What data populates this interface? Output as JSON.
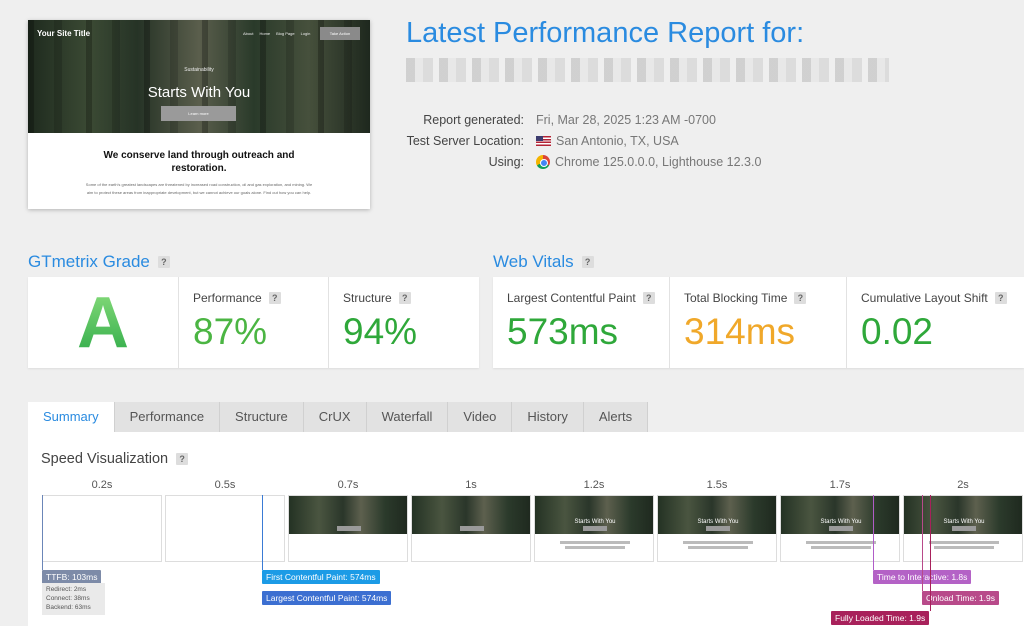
{
  "preview": {
    "site_title": "Your Site Title",
    "nav": [
      "About",
      "Home",
      "Blog Page",
      "Login"
    ],
    "cta": "Take Action",
    "kicker": "Sustainability",
    "heading": "Starts With You",
    "learn_more": "Learn more",
    "headline": "We conserve land through outreach and restoration.",
    "body": "Some of the earth's greatest landscapes are threatened by increased road construction, oil and gas exploration, and mining. We aim to protect these areas from inappropriate development, but we cannot achieve our goals alone. Find out how you can help."
  },
  "report": {
    "title": "Latest Performance Report for:",
    "meta": [
      {
        "label": "Report generated:",
        "value": "Fri, Mar 28, 2025 1:23 AM -0700",
        "icon": ""
      },
      {
        "label": "Test Server Location:",
        "value": "San Antonio, TX, USA",
        "icon": "us-flag-icon"
      },
      {
        "label": "Using:",
        "value": "Chrome 125.0.0.0, Lighthouse 12.3.0",
        "icon": "chrome-icon"
      }
    ]
  },
  "grade": {
    "heading": "GTmetrix Grade",
    "letter": "A",
    "performance_label": "Performance",
    "performance_value": "87%",
    "structure_label": "Structure",
    "structure_value": "94%"
  },
  "vitals": {
    "heading": "Web Vitals",
    "lcp_label": "Largest Contentful Paint",
    "lcp_value": "573ms",
    "tbt_label": "Total Blocking Time",
    "tbt_value": "314ms",
    "cls_label": "Cumulative Layout Shift",
    "cls_value": "0.02"
  },
  "colors": {
    "accent": "#2a8be0",
    "good": "#2fa83a",
    "warn": "#f0a82a"
  },
  "tabs": [
    "Summary",
    "Performance",
    "Structure",
    "CrUX",
    "Waterfall",
    "Video",
    "History",
    "Alerts"
  ],
  "speed": {
    "title": "Speed Visualization",
    "frames": [
      {
        "time": "0.2s",
        "state": "blank"
      },
      {
        "time": "0.5s",
        "state": "blank"
      },
      {
        "time": "0.7s",
        "state": "hero"
      },
      {
        "time": "1s",
        "state": "hero"
      },
      {
        "time": "1.2s",
        "state": "full"
      },
      {
        "time": "1.5s",
        "state": "full"
      },
      {
        "time": "1.7s",
        "state": "full"
      },
      {
        "time": "2s",
        "state": "full"
      }
    ],
    "frame_heading": "Starts With You",
    "ttfb": "TTFB: 103ms",
    "redirect": "Redirect: 2ms",
    "connect": "Connect: 38ms",
    "backend": "Backend: 63ms",
    "fcp": "First Contentful Paint: 574ms",
    "lcp": "Largest Contentful Paint: 574ms",
    "tti": "Time to Interactive: 1.8s",
    "onload": "Onload Time: 1.9s",
    "fully_loaded": "Fully Loaded Time: 1.9s"
  }
}
